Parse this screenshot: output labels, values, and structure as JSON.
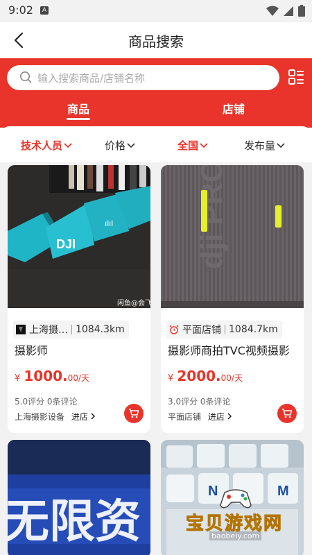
{
  "status_bar": {
    "time": "9:02",
    "indicator": "A"
  },
  "header": {
    "title": "商品搜索",
    "back_icon": "back-arrow-icon"
  },
  "search": {
    "placeholder": "输入搜索商品/店铺名称",
    "grid_icon": "list-grid-icon"
  },
  "tabs": [
    {
      "label": "商品",
      "active": true
    },
    {
      "label": "店铺",
      "active": false
    }
  ],
  "filters": [
    {
      "label": "技术人员",
      "active": true
    },
    {
      "label": "价格",
      "active": false
    },
    {
      "label": "全国",
      "active": true
    },
    {
      "label": "发布量",
      "active": false
    }
  ],
  "products": [
    {
      "shop_name": "上海摄…",
      "distance": "1084.3km",
      "title": "摄影师",
      "price_symbol": "¥",
      "price_value": "1000.",
      "price_decimal": "00",
      "price_unit": "/天",
      "rating_text": "5.0评分 0条评论",
      "shop_line": "上海摄影设备",
      "enter_label": "进店",
      "image_caption": "闲鱼@会飞"
    },
    {
      "shop_name": "平面店铺",
      "distance": "1084.7km",
      "title": "摄影师商拍TVC视频摄影",
      "price_symbol": "¥",
      "price_value": "2000.",
      "price_decimal": "00",
      "price_unit": "/天",
      "rating_text": "3.0评分 0条评论",
      "shop_line": "平面店铺",
      "enter_label": "进店"
    }
  ],
  "colors": {
    "accent": "#e8342a",
    "background": "#f2f2f2"
  },
  "watermark": {
    "text": "宝贝游戏网",
    "url": "baobeiy.com"
  }
}
